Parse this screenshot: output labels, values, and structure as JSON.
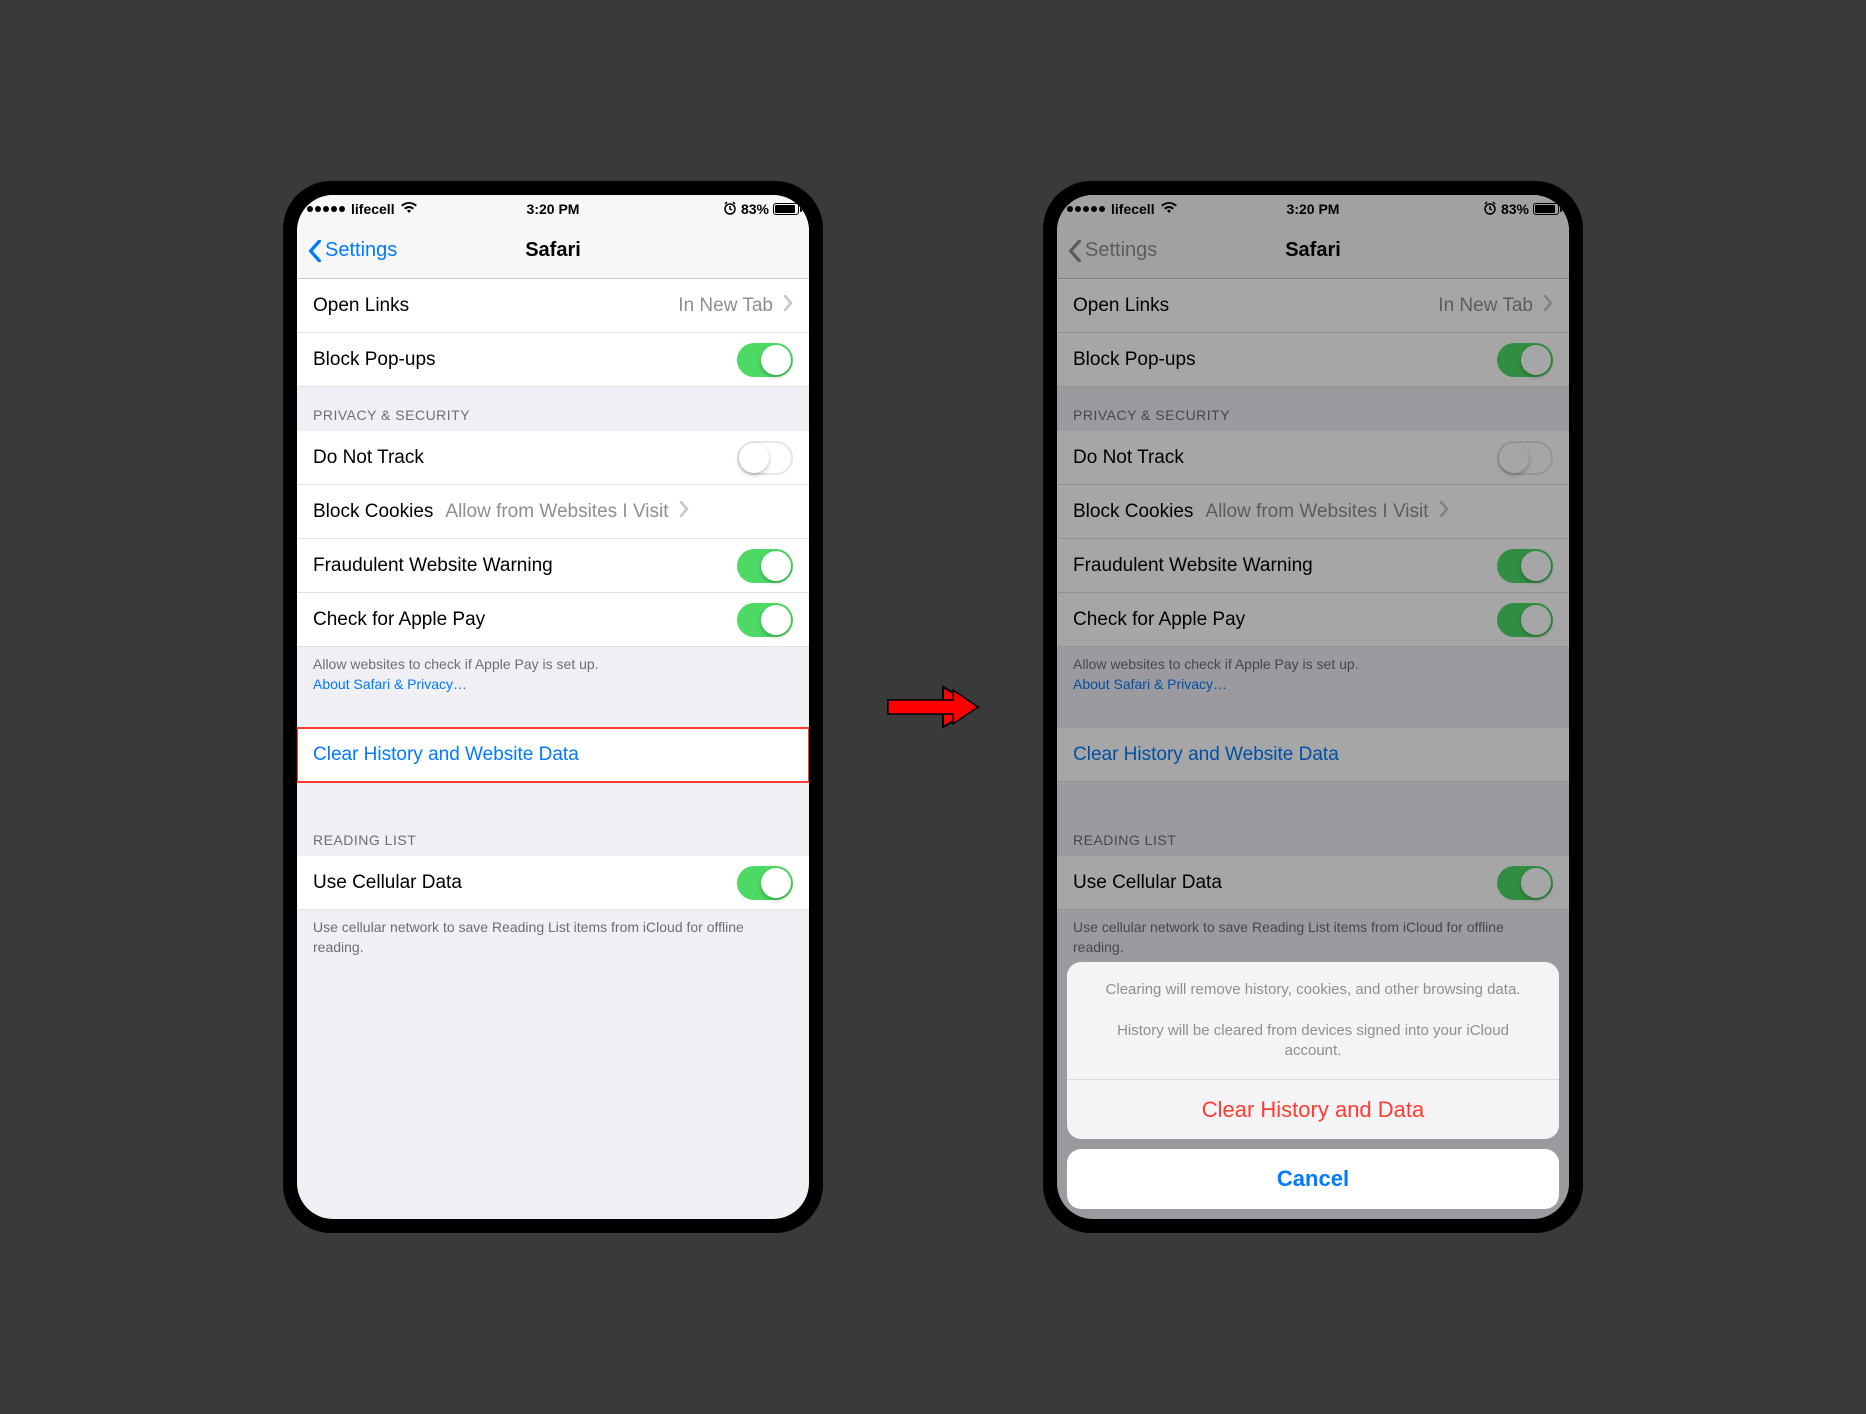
{
  "status": {
    "carrier": "lifecell",
    "time": "3:20 PM",
    "battery_pct": "83%",
    "alarm_icon": "⏰"
  },
  "nav": {
    "back_label": "Settings",
    "title": "Safari"
  },
  "general": {
    "open_links_label": "Open Links",
    "open_links_value": "In New Tab",
    "block_popups_label": "Block Pop-ups",
    "block_popups_on": true
  },
  "privacy": {
    "header": "PRIVACY & SECURITY",
    "dnt_label": "Do Not Track",
    "dnt_on": false,
    "block_cookies_label": "Block Cookies",
    "block_cookies_value": "Allow from Websites I Visit",
    "fraud_label": "Fraudulent Website Warning",
    "fraud_on": true,
    "apple_pay_label": "Check for Apple Pay",
    "apple_pay_on": true,
    "footer_line1": "Allow websites to check if Apple Pay is set up.",
    "footer_link": "About Safari & Privacy…"
  },
  "clear": {
    "label": "Clear History and Website Data"
  },
  "reading": {
    "header": "READING LIST",
    "cellular_label": "Use Cellular Data",
    "cellular_on": true,
    "footer": "Use cellular network to save Reading List items from iCloud for offline reading."
  },
  "sheet": {
    "msg_line1": "Clearing will remove history, cookies, and other browsing data.",
    "msg_line2": "History will be cleared from devices signed into your iCloud account.",
    "destructive": "Clear History and Data",
    "cancel": "Cancel"
  }
}
